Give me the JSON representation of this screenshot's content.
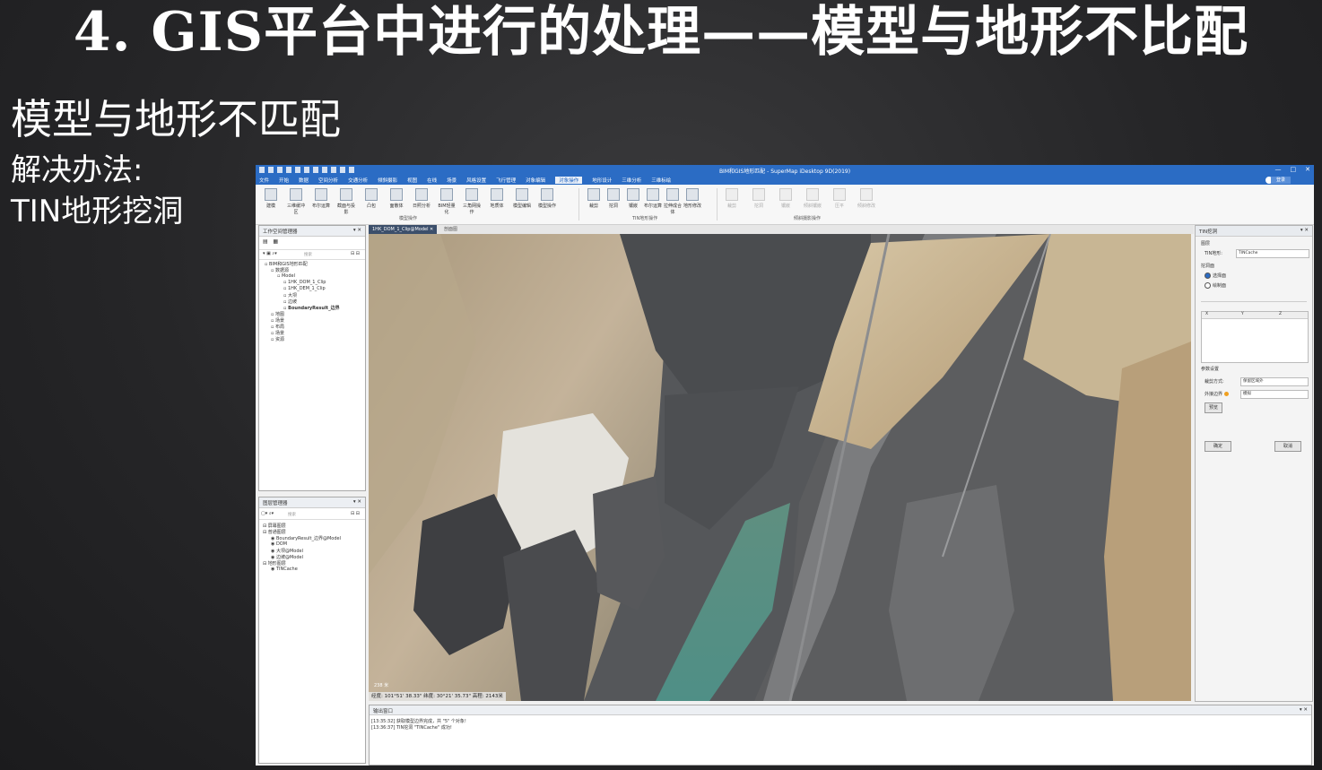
{
  "slide": {
    "title": "4. GIS平台中进行的处理——模型与地形不比配",
    "subtitle": "模型与地形不匹配",
    "solution_label": "解决办法:",
    "solution_item": "TIN地形挖洞"
  },
  "app": {
    "window_title": "BIM和GIS地形匹配 - SuperMap iDesktop 9D(2019)",
    "window_buttons": [
      "—",
      "□",
      "✕"
    ],
    "login_label": "登录",
    "menu": [
      "文件",
      "开始",
      "数据",
      "空间分析",
      "交通分析",
      "倾斜摄影",
      "视图",
      "在线",
      "场景",
      "风格设置",
      "飞行管理",
      "对象编辑",
      "对象操作",
      "地形设计",
      "三维分析",
      "三维标绘"
    ],
    "active_menu": "对象操作",
    "ribbon_buttons": [
      {
        "label": "建模",
        "group": 1,
        "disabled": false
      },
      {
        "label": "三维缓冲区",
        "group": 1,
        "disabled": false
      },
      {
        "label": "布尔运算",
        "group": 1,
        "disabled": false
      },
      {
        "label": "截面与投影",
        "group": 1,
        "disabled": false
      },
      {
        "label": "凸包",
        "group": 1,
        "disabled": false
      },
      {
        "label": "面散体",
        "group": 1,
        "disabled": false
      },
      {
        "label": "日照分析",
        "group": 1,
        "disabled": false
      },
      {
        "label": "BIM轻量化",
        "group": 1,
        "disabled": false
      },
      {
        "label": "三角网操作",
        "group": 1,
        "disabled": false
      },
      {
        "label": "地质体",
        "group": 1,
        "disabled": false
      },
      {
        "label": "模型编辑",
        "group": 1,
        "disabled": false
      },
      {
        "label": "模型操作",
        "group": 1,
        "disabled": false
      },
      {
        "label": "裁剪",
        "group": 2,
        "disabled": false
      },
      {
        "label": "挖洞",
        "group": 2,
        "disabled": false
      },
      {
        "label": "镶嵌",
        "group": 2,
        "disabled": false
      },
      {
        "label": "布尔运算",
        "group": 2,
        "disabled": false
      },
      {
        "label": "拉伸成合体",
        "group": 2,
        "disabled": false
      },
      {
        "label": "地形修改",
        "group": 2,
        "disabled": false
      },
      {
        "label": "裁剪",
        "group": 3,
        "disabled": true
      },
      {
        "label": "挖洞",
        "group": 3,
        "disabled": true
      },
      {
        "label": "镶嵌",
        "group": 3,
        "disabled": true
      },
      {
        "label": "倾斜镶嵌",
        "group": 3,
        "disabled": true
      },
      {
        "label": "压平",
        "group": 3,
        "disabled": true
      },
      {
        "label": "倾斜修改",
        "group": 3,
        "disabled": true
      }
    ],
    "ribbon_groups": [
      "模型操作",
      "TIN地形操作",
      "倾斜摄影操作"
    ],
    "workspace_panel": {
      "title": "工作空间管理器",
      "search_placeholder": "搜索",
      "tree": [
        {
          "label": "BIM和GIS地形匹配",
          "level": 1,
          "bold": false
        },
        {
          "label": "数据源",
          "level": 2,
          "bold": false
        },
        {
          "label": "Model",
          "level": 3,
          "bold": false
        },
        {
          "label": "1HK_DOM_1_Clip",
          "level": 4,
          "bold": false
        },
        {
          "label": "1HK_DEM_1_Clip",
          "level": 4,
          "bold": false
        },
        {
          "label": "大坝",
          "level": 4,
          "bold": false
        },
        {
          "label": "边坡",
          "level": 4,
          "bold": false
        },
        {
          "label": "BoundaryResult_边界",
          "level": 4,
          "bold": true
        },
        {
          "label": "地图",
          "level": 2,
          "bold": false
        },
        {
          "label": "场景",
          "level": 2,
          "bold": false
        },
        {
          "label": "布局",
          "level": 2,
          "bold": false
        },
        {
          "label": "场景",
          "level": 2,
          "bold": false
        },
        {
          "label": "资源",
          "level": 2,
          "bold": false
        }
      ]
    },
    "layer_panel": {
      "title": "图层管理器",
      "search_placeholder": "搜索",
      "tree": [
        {
          "label": "屏幕图层",
          "level": 1
        },
        {
          "label": "普通图层",
          "level": 1
        },
        {
          "label": "BoundaryResult_边界@Model",
          "level": 2
        },
        {
          "label": "DOM",
          "level": 2
        },
        {
          "label": "大坝@Model",
          "level": 2
        },
        {
          "label": "边坡@Model",
          "level": 2
        },
        {
          "label": "地形图层",
          "level": 1
        },
        {
          "label": "TINCache",
          "level": 2
        }
      ]
    },
    "doc_tabs": [
      {
        "label": "1HK_DOM_1_Clip@Model",
        "active": true
      },
      {
        "label": "剖面图",
        "active": false
      }
    ],
    "scene_status": "经度: 101°51' 38.33\"  纬度: 30°21' 35.73\"  高程: 2143米",
    "scene_scale": "238 米",
    "output_panel": {
      "title": "输出窗口",
      "lines": [
        "[13:35:32] 获取模型边界完成，共 \"5\" 个对象!",
        "[13:36:37] TIN挖洞 \"TINCache\" 成功!"
      ]
    },
    "tin_panel": {
      "title": "TIN挖洞",
      "layer_section": "图层",
      "tin_label": "TIN地形:",
      "tin_value": "TINCache",
      "hole_section": "挖洞面",
      "radio_options": [
        "选择面",
        "绘制面"
      ],
      "radio_selected": 0,
      "table_headers": [
        "X",
        "Y",
        "Z"
      ],
      "param_section": "参数设置",
      "clip_mode_label": "裁剪方式:",
      "clip_mode_value": "保留区域外",
      "border_label": "外接边界",
      "border_value": "模拟",
      "preview_label": "预览",
      "ok_label": "确定",
      "cancel_label": "取消"
    }
  }
}
